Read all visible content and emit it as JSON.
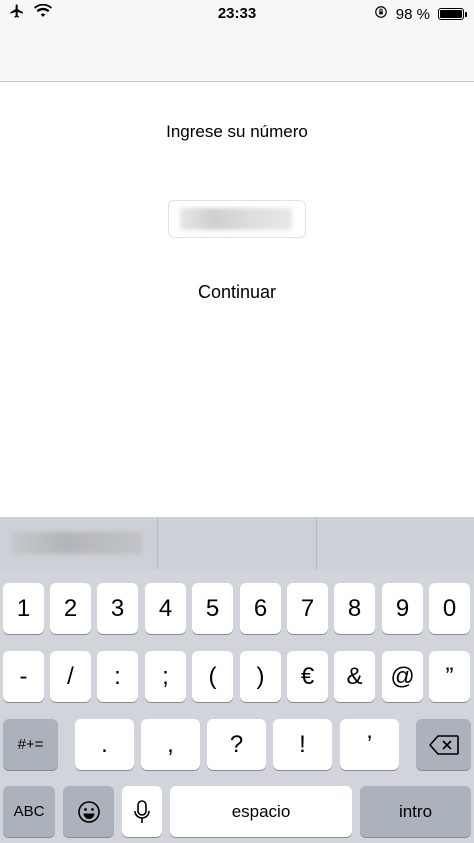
{
  "status_bar": {
    "time": "23:33",
    "battery_text": "98 %",
    "icons": [
      "airplane-icon",
      "wifi-icon",
      "rotation-lock-icon",
      "battery-icon"
    ]
  },
  "main": {
    "prompt": "Ingrese su número",
    "phone_value": "",
    "continue_label": "Continuar"
  },
  "keyboard": {
    "row1": [
      "1",
      "2",
      "3",
      "4",
      "5",
      "6",
      "7",
      "8",
      "9",
      "0"
    ],
    "row2": [
      "-",
      "/",
      ":",
      ";",
      "(",
      ")",
      "€",
      "&",
      "@",
      "”"
    ],
    "row3": {
      "shift_label": "#+=",
      "keys": [
        ".",
        ",",
        "?",
        "!",
        "’"
      ]
    },
    "row4": {
      "abc_label": "ABC",
      "space_label": "espacio",
      "return_label": "intro"
    }
  }
}
